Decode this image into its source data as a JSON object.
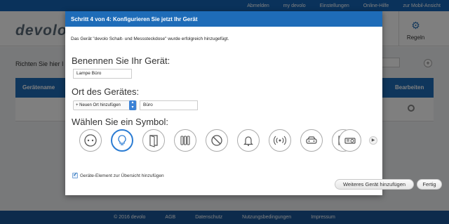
{
  "top_nav": [
    "Abmelden",
    "my devolo",
    "Einstellungen",
    "Online-Hilfe",
    "zur Mobil-Ansicht"
  ],
  "header": {
    "logo": "devolo",
    "rules_label": "Regeln"
  },
  "background": {
    "search_label": "Richten Sie hier I",
    "table_headers": [
      "Gerätename",
      "Bearbeiten"
    ]
  },
  "footer": [
    "© 2016 devolo",
    "AGB",
    "Datenschutz",
    "Nutzungsbedingungen",
    "Impressum"
  ],
  "modal": {
    "title": "Schritt 4 von 4: Konfigurieren Sie jetzt Ihr Gerät",
    "success_message": "Das Gerät \"devolo Schalt- und Messsteckdose\" wurde erfolgreich hinzugefügt.",
    "name_section": "Benennen Sie Ihr Gerät:",
    "name_value": "Lampe Büro",
    "location_section": "Ort des Gerätes:",
    "location_select": "+ Neuen Ort hinzufügen",
    "location_value": "Büro",
    "symbol_section": "Wählen Sie ein Symbol:",
    "symbols": [
      "socket-icon",
      "lightbulb-icon",
      "door-icon",
      "radiator-icon",
      "forbidden-icon",
      "bell-icon",
      "antenna-icon",
      "car-icon",
      "oven-icon",
      "projector-icon"
    ],
    "selected_symbol": "lightbulb-icon",
    "checkbox_label": "Geräte-Element zur Übersicht hinzufügen",
    "checkbox_checked": true,
    "btn_more": "Weiteres Gerät hinzufügen",
    "btn_done": "Fertig"
  },
  "colors": {
    "primary_blue": "#1e6cb8",
    "selected_ring": "#2b7cd3"
  }
}
